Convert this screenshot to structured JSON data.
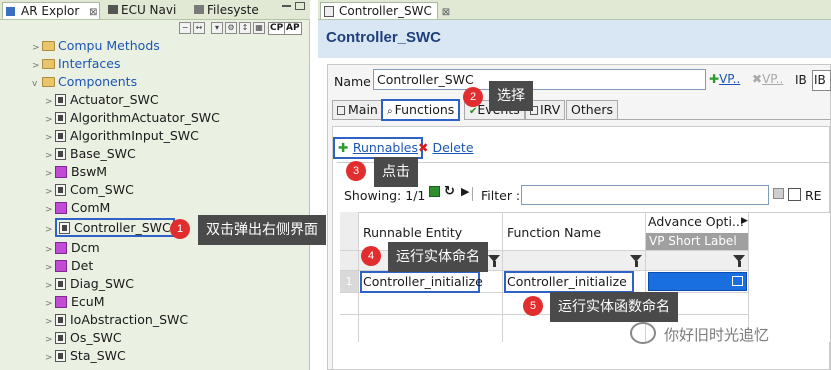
{
  "left_panel": {
    "tabs": [
      {
        "label": "AR Explor",
        "close": "⊠"
      },
      {
        "label": "ECU Navi"
      },
      {
        "label": "Filesyste"
      }
    ],
    "toolbar_labels": [
      "CP",
      "AP"
    ],
    "tree": [
      {
        "label": "Compu Methods",
        "kind": "folder"
      },
      {
        "label": "Interfaces",
        "kind": "folder"
      },
      {
        "label": "Components",
        "kind": "folder-open"
      },
      {
        "label": "Actuator_SWC",
        "kind": "swc"
      },
      {
        "label": "AlgorithmActuator_SWC",
        "kind": "swc"
      },
      {
        "label": "AlgorithmInput_SWC",
        "kind": "swc"
      },
      {
        "label": "Base_SWC",
        "kind": "swc"
      },
      {
        "label": "BswM",
        "kind": "bsw"
      },
      {
        "label": "Com_SWC",
        "kind": "swc"
      },
      {
        "label": "ComM",
        "kind": "bsw"
      },
      {
        "label": "Controller_SWC",
        "kind": "swc",
        "selected": true
      },
      {
        "label": "Dcm",
        "kind": "bsw"
      },
      {
        "label": "Det",
        "kind": "bsw"
      },
      {
        "label": "Diag_SWC",
        "kind": "swc"
      },
      {
        "label": "EcuM",
        "kind": "bsw"
      },
      {
        "label": "IoAbstraction_SWC",
        "kind": "swc"
      },
      {
        "label": "Os_SWC",
        "kind": "swc"
      },
      {
        "label": "Sta_SWC",
        "kind": "swc"
      }
    ]
  },
  "editor": {
    "tab_label": "Controller_SWC",
    "tab_close": "⊠",
    "header_title": "Controller_SWC",
    "name_label": "Name",
    "name_value": "Controller_SWC",
    "name_actions": [
      "VP..",
      "VP..",
      "IB",
      "IB"
    ],
    "sub_tabs": [
      "Main",
      "Functions",
      "Events",
      "IRV",
      "Others"
    ],
    "runnables_link": "Runnables",
    "delete_link": "Delete",
    "showing": "Showing: 1/1",
    "filter_label": "Filter :",
    "filter_value": "",
    "re_label": "RE",
    "table": {
      "headers": [
        "Runnable Entity",
        "Function Name",
        "Advance Opti..."
      ],
      "subheader": "VP Short Label",
      "rows": [
        {
          "index": "1",
          "runnable": "Controller_initialize",
          "function": "Controller_initialize"
        }
      ]
    }
  },
  "annotations": [
    {
      "num": "1",
      "text": "双击弹出右侧界面"
    },
    {
      "num": "2",
      "text": "选择"
    },
    {
      "num": "3",
      "text": "点击"
    },
    {
      "num": "4",
      "text": "运行实体命名"
    },
    {
      "num": "5",
      "text": "运行实体函数命名"
    }
  ],
  "watermark": "你好旧时光追忆",
  "colors": {
    "accent": "#2f62c7",
    "badge": "#e12d2d",
    "callout_bg": "#4a4a4a",
    "header_bg": "#d9e7f5"
  }
}
